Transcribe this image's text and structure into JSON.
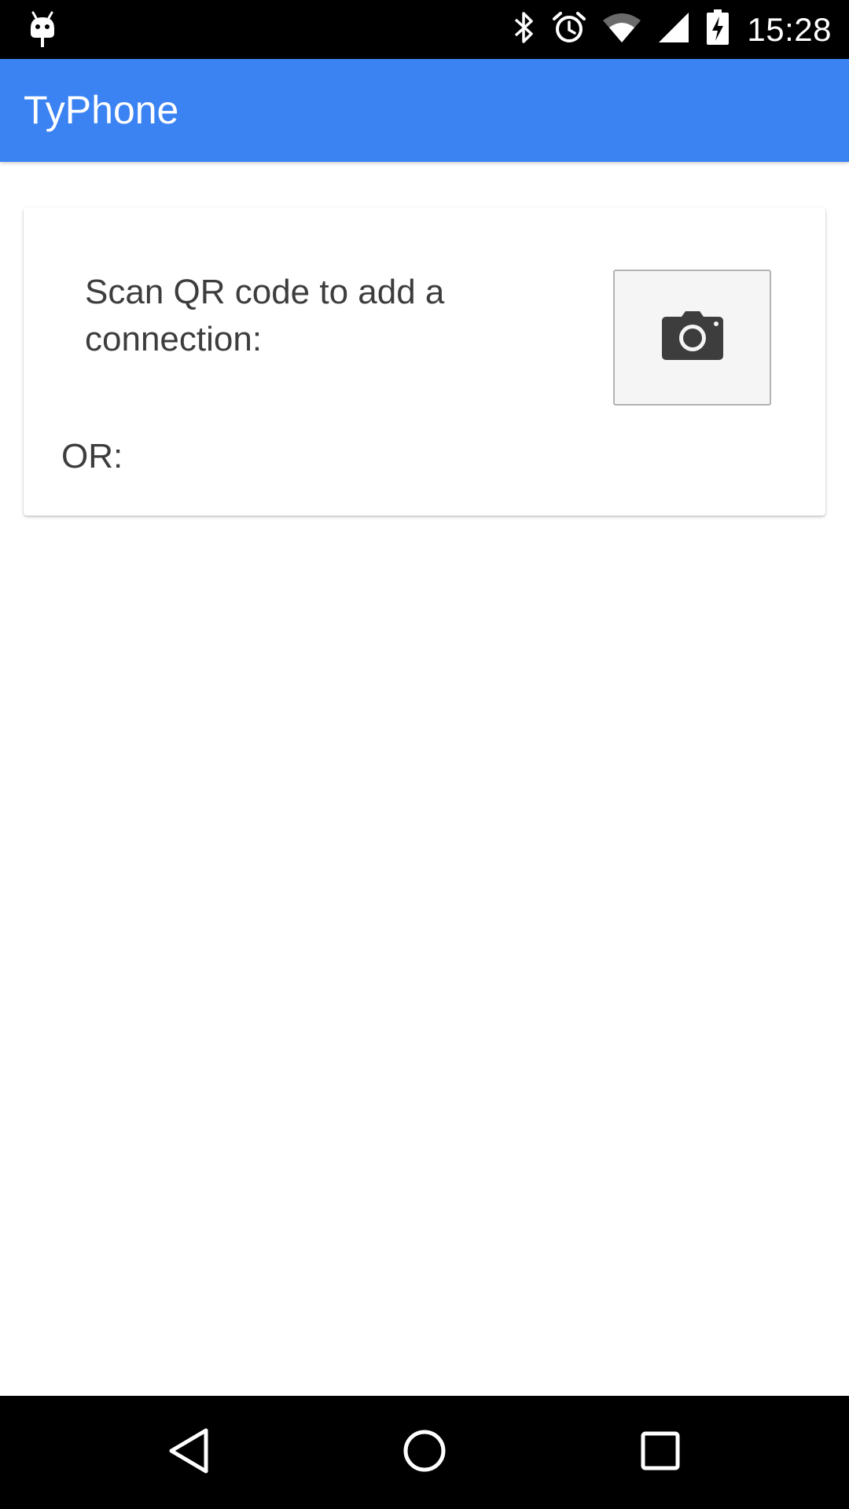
{
  "status_bar": {
    "time": "15:28",
    "icons": [
      "android-debug-icon",
      "bluetooth-icon",
      "alarm-icon",
      "wifi-icon",
      "cell-signal-icon",
      "battery-charging-icon"
    ]
  },
  "app_bar": {
    "title": "TyPhone",
    "color": "#3b82f2"
  },
  "card": {
    "scan_label": "Scan QR code to add a connection:",
    "camera_button_icon": "camera-icon",
    "or_label": "OR:"
  },
  "nav_bar": {
    "buttons": [
      "back-icon",
      "home-icon",
      "recents-icon"
    ]
  }
}
